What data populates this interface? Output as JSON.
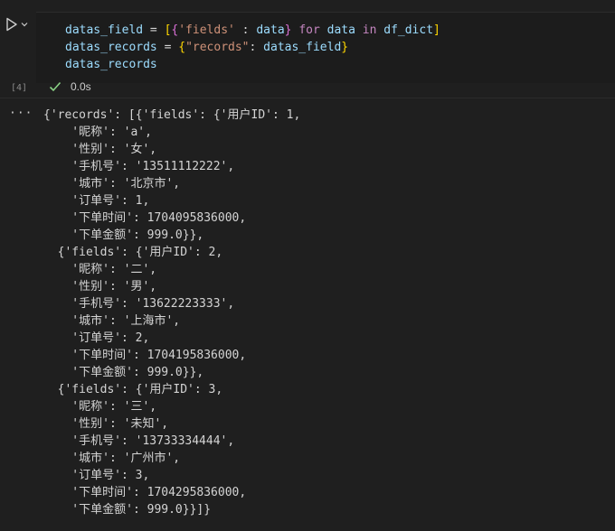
{
  "cell": {
    "execution_count": "[4]",
    "duration": "0.0s",
    "code_lines": [
      [
        {
          "t": "datas_field",
          "c": "var"
        },
        {
          "t": " = ",
          "c": "op"
        },
        {
          "t": "[",
          "c": "br1"
        },
        {
          "t": "{",
          "c": "br2"
        },
        {
          "t": "'fields'",
          "c": "str"
        },
        {
          "t": " : ",
          "c": "op"
        },
        {
          "t": "data",
          "c": "var"
        },
        {
          "t": "}",
          "c": "br2"
        },
        {
          "t": " ",
          "c": "op"
        },
        {
          "t": "for",
          "c": "kw"
        },
        {
          "t": " data ",
          "c": "var"
        },
        {
          "t": "in",
          "c": "kw"
        },
        {
          "t": " df_dict",
          "c": "var"
        },
        {
          "t": "]",
          "c": "br1"
        }
      ],
      [
        {
          "t": "datas_records",
          "c": "var"
        },
        {
          "t": " = ",
          "c": "op"
        },
        {
          "t": "{",
          "c": "br1"
        },
        {
          "t": "\"records\"",
          "c": "str"
        },
        {
          "t": ": ",
          "c": "op"
        },
        {
          "t": "datas_field",
          "c": "var"
        },
        {
          "t": "}",
          "c": "br1"
        }
      ],
      [
        {
          "t": "datas_records",
          "c": "var"
        }
      ]
    ]
  },
  "output": {
    "menu_label": "···",
    "lines": [
      "{'records': [{'fields': {'用户ID': 1,",
      "    '昵称': 'a',",
      "    '性别': '女',",
      "    '手机号': '13511112222',",
      "    '城市': '北京市',",
      "    '订单号': 1,",
      "    '下单时间': 1704095836000,",
      "    '下单金额': 999.0}},",
      "  {'fields': {'用户ID': 2,",
      "    '昵称': '二',",
      "    '性别': '男',",
      "    '手机号': '13622223333',",
      "    '城市': '上海市',",
      "    '订单号': 2,",
      "    '下单时间': 1704195836000,",
      "    '下单金额': 999.0}},",
      "  {'fields': {'用户ID': 3,",
      "    '昵称': '三',",
      "    '性别': '未知',",
      "    '手机号': '13733334444',",
      "    '城市': '广州市',",
      "    '订单号': 3,",
      "    '下单时间': 1704295836000,",
      "    '下单金额': 999.0}}]}"
    ]
  },
  "colors": {
    "background": "#1f1f1f",
    "code_background": "#1c1c1c",
    "variable": "#9cdcfe",
    "string": "#ce9178",
    "keyword": "#c586c0",
    "bracket_outer": "#ffd700",
    "bracket_inner": "#da70d6",
    "success_check": "#89d185"
  },
  "icons": {
    "run": "run-cell-icon",
    "expand": "chevron-down-icon",
    "status": "check-icon"
  }
}
